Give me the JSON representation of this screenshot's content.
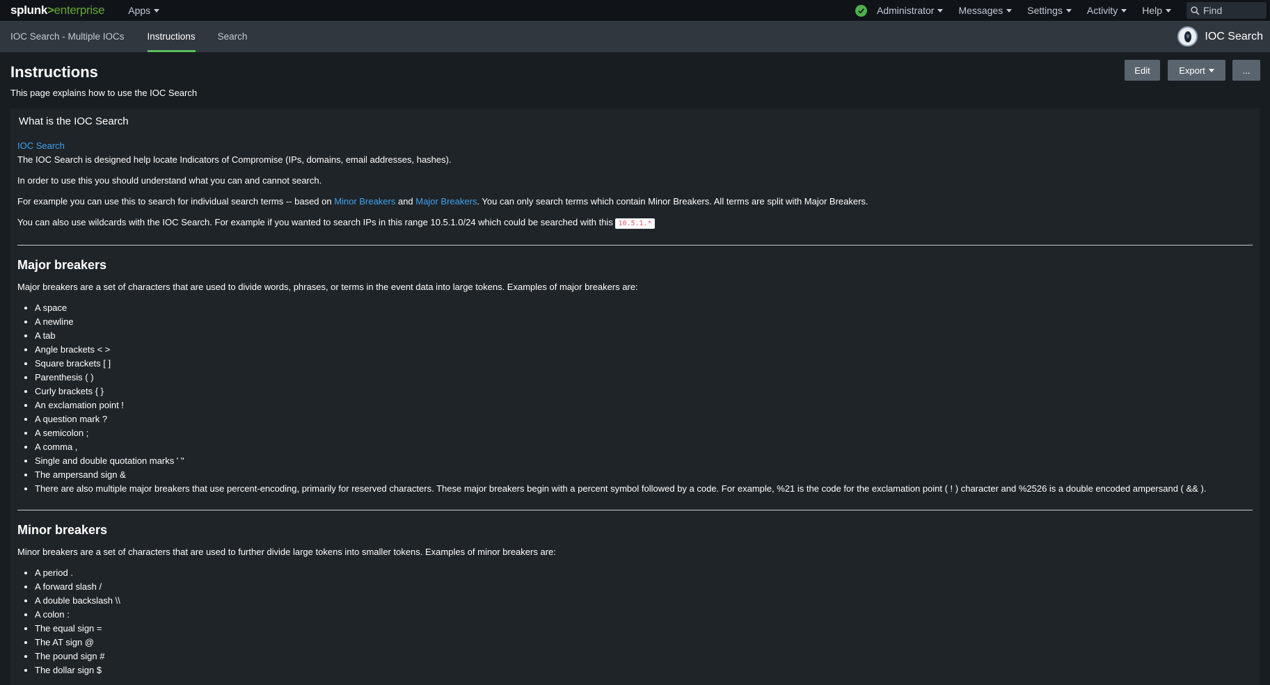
{
  "topbar": {
    "logo": {
      "part1": "splunk",
      "part2": ">",
      "part3": "enterprise"
    },
    "apps_label": "Apps",
    "menus": [
      "Administrator",
      "Messages",
      "Settings",
      "Activity",
      "Help"
    ],
    "find_placeholder": "Find"
  },
  "appbar": {
    "tabs": [
      {
        "label": "IOC Search - Multiple IOCs",
        "active": false
      },
      {
        "label": "Instructions",
        "active": true
      },
      {
        "label": "Search",
        "active": false
      }
    ],
    "app_title": "IOC Search"
  },
  "dashboard": {
    "title": "Instructions",
    "description": "This page explains how to use the IOC Search",
    "buttons": {
      "edit": "Edit",
      "export": "Export",
      "more": "..."
    }
  },
  "panel": {
    "title": "What is the IOC Search",
    "link_title": "IOC Search",
    "p1": "The IOC Search is designed help locate Indicators of Compromise (IPs, domains, email addresses, hashes).",
    "p2": "In order to use this you should understand what you can and cannot search.",
    "p3_pre": "For example you can use this to search for individual search terms -- based on ",
    "p3_link1": "Minor Breakers",
    "p3_mid": " and ",
    "p3_link2": "Major Breakers",
    "p3_post": ". You can only search terms which contain Minor Breakers. All terms are split with Major Breakers.",
    "p4_pre": "You can also use wildcards with the IOC Search. For example if you wanted to search IPs in this range 10.5.1.0/24 which could be searched with this ",
    "p4_code": "10.5.1.*",
    "major": {
      "heading": "Major breakers",
      "intro": "Major breakers are a set of characters that are used to divide words, phrases, or terms in the event data into large tokens. Examples of major breakers are:",
      "items": [
        "A space",
        "A newline",
        "A tab",
        "Angle brackets < >",
        "Square brackets [ ]",
        "Parenthesis ( )",
        "Curly brackets { }",
        "An exclamation point !",
        "A question mark ?",
        "A semicolon ;",
        "A comma ,",
        "Single and double quotation marks ' \"",
        "The ampersand sign &",
        "There are also multiple major breakers that use percent-encoding, primarily for reserved characters. These major breakers begin with a percent symbol followed by a code. For example, %21 is the code for the exclamation point ( ! ) character and %2526 is a double encoded ampersand ( && )."
      ]
    },
    "minor": {
      "heading": "Minor breakers",
      "intro": "Minor breakers are a set of characters that are used to further divide large tokens into smaller tokens. Examples of minor breakers are:",
      "items": [
        "A period .",
        "A forward slash /",
        "A double backslash \\\\",
        "A colon :",
        "The equal sign =",
        "The AT sign @",
        "The pound sign #",
        "The dollar sign $"
      ]
    }
  },
  "colors": {
    "accent_green": "#5cc05c",
    "link_blue": "#3ea3ef",
    "status_ok": "#4db04a"
  }
}
